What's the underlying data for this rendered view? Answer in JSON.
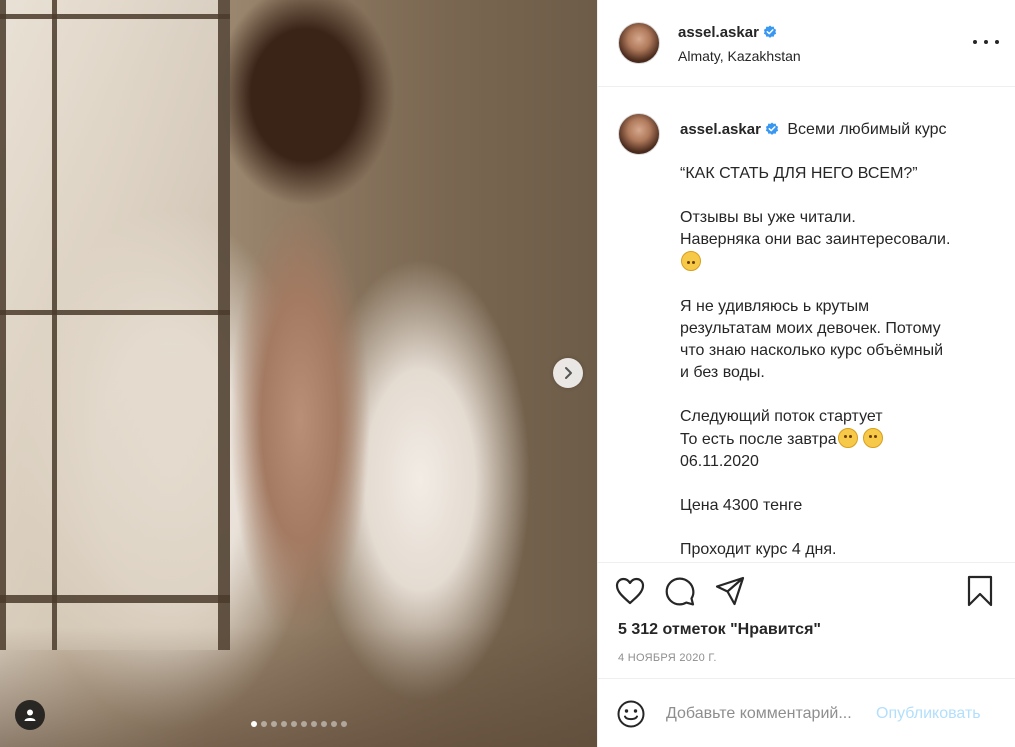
{
  "photo": {
    "next_icon": "chevron-right-icon",
    "user_tag_icon": "person-icon",
    "carousel_count": 10,
    "carousel_active_index": 0
  },
  "header": {
    "username": "assel.askar",
    "verified": true,
    "location": "Almaty, Kazakhstan",
    "more_icon": "more-horizontal-icon"
  },
  "caption": {
    "username": "assel.askar",
    "lines": [
      "Всеми любимый курс",
      "",
      "“КАК СТАТЬ ДЛЯ НЕГО ВСЕМ?”",
      "",
      "Отзывы вы уже читали.",
      "Наверняка они вас заинтересовали.",
      "",
      "",
      "Я не удивляюсь ь крутым",
      "результатам моих девочек. Потому",
      "что знаю насколько курс объёмный",
      "и без воды.",
      "",
      "Следующий поток стартует",
      "То есть после завтра",
      "06.11.2020",
      "",
      "Цена 4300 тенге",
      "",
      "Проходит курс 4 дня."
    ],
    "emoji_upside_down": "upside-down-face-emoji",
    "emoji_scream": "face-screaming-emoji",
    "emoji_smile": "smiling-face-emoji"
  },
  "actions": {
    "like_icon": "heart-icon",
    "comment_icon": "comment-icon",
    "share_icon": "send-icon",
    "save_icon": "bookmark-icon",
    "likes_text": "5 312 отметок \"Нравится\"",
    "date_text": "4 НОЯБРЯ 2020 Г."
  },
  "comment": {
    "emoji_icon": "smiley-icon",
    "placeholder": "Добавьте комментарий...",
    "publish_label": "Опубликовать"
  },
  "colors": {
    "verified_blue": "#3897f0",
    "publish_disabled": "#b2dffc",
    "text": "#262626",
    "secondary_text": "#8e8e8e",
    "border": "#efefef"
  }
}
